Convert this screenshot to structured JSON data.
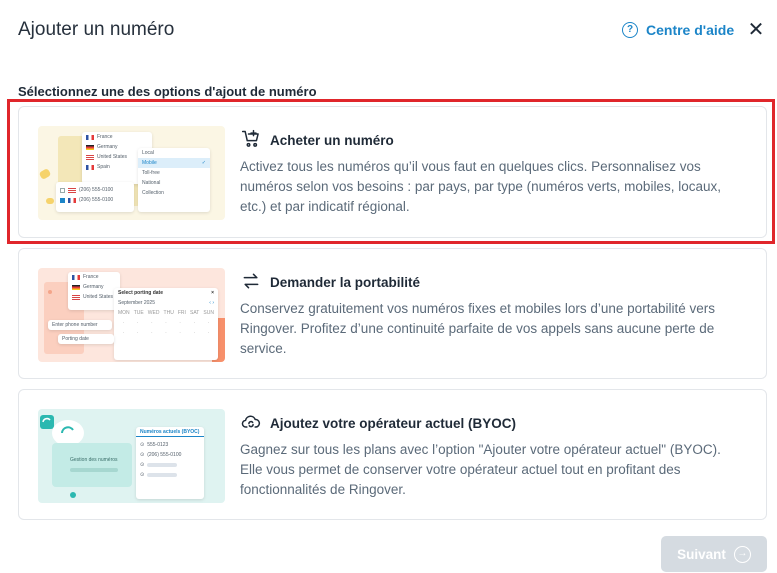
{
  "header": {
    "title": "Ajouter un numéro",
    "help_label": "Centre d'aide",
    "help_icon": "question-circle-icon",
    "close_symbol": "✕"
  },
  "subtitle": "Sélectionnez une des options d'ajout de numéro",
  "colors": {
    "accent": "#1c85c8",
    "highlight": "#e0262b",
    "disabled_button": "#d5dbe1"
  },
  "options": [
    {
      "icon": "cart-plus-icon",
      "title": "Acheter un numéro",
      "description": "Activez tous les numéros qu’il vous faut en quelques clics. Personnalisez vos numéros selon vos besoins : par pays, par type (numéros verts, mobiles, locaux, etc.) et par indicatif régional.",
      "thumb": {
        "countries": [
          "France",
          "Germany",
          "United States",
          "Spain"
        ],
        "types": [
          "Local",
          "Mobile",
          "Toll-free",
          "National",
          "Collection"
        ],
        "numbers": [
          "(206) 555-0100",
          "(206) 555-0100"
        ]
      }
    },
    {
      "icon": "swap-arrows-icon",
      "title": "Demander la portabilité",
      "description": "Conservez gratuitement vos numéros fixes et mobiles lors d’une portabilité vers Ringover. Profitez d’une continuité parfaite de vos appels sans aucune perte de service.",
      "thumb": {
        "countries": [
          "France",
          "Germany",
          "United States"
        ],
        "calendar_title": "Select porting date",
        "calendar_month": "September 2025",
        "weekdays": [
          "MON",
          "TUE",
          "WED",
          "THU",
          "FRI",
          "SAT",
          "SUN"
        ],
        "field1": "Enter phone number",
        "field2": "Porting date"
      }
    },
    {
      "icon": "cloud-sync-icon",
      "title": "Ajoutez votre opérateur actuel (BYOC)",
      "description": "Gagnez sur tous les plans avec l’option \"Ajouter votre opérateur actuel\" (BYOC). Elle vous permet de conserver votre opérateur actuel tout en profitant des fonctionnalités de Ringover.",
      "thumb": {
        "panel_title": "Numéros actuels (BYOC)",
        "caption": "Gestion des numéros",
        "numbers": [
          "555-0123",
          "(206) 555-0100"
        ]
      }
    }
  ],
  "footer": {
    "next_label": "Suivant",
    "next_icon": "arrow-right-circle-icon"
  }
}
